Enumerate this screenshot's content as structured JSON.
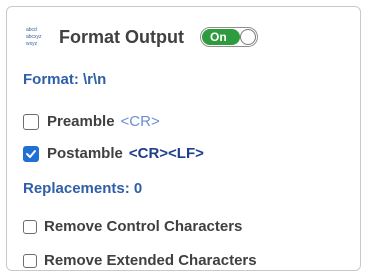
{
  "panel": {
    "icon": "format-output-icon",
    "title": "Format Output",
    "toggle": {
      "label": "On",
      "state": "on",
      "color": "#2e9b3f"
    },
    "format_line": "Format: \\r\\n",
    "preamble": {
      "label": "Preamble",
      "code": "<CR>",
      "checked": false
    },
    "postamble": {
      "label": "Postamble",
      "code": "<CR><LF>",
      "checked": true
    },
    "replacements": "Replacements: 0",
    "remove_control": {
      "label": "Remove Control Characters",
      "checked": false
    },
    "remove_extended": {
      "label": "Remove Extended Characters",
      "checked": false
    }
  },
  "colors": {
    "accent_blue": "#2f5fa8",
    "checkbox_blue": "#1f6fd6",
    "toggle_green": "#2e9b3f"
  }
}
